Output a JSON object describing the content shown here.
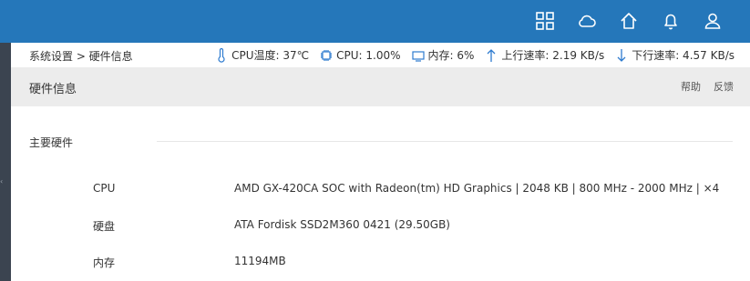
{
  "topbar": {
    "icons": [
      "apps-grid-icon",
      "cloud-icon",
      "home-icon",
      "bell-icon",
      "user-icon"
    ]
  },
  "breadcrumb": {
    "path": "系统设置 > 硬件信息"
  },
  "status": {
    "cpu_temp": "CPU温度: 37℃",
    "cpu_usage": "CPU: 1.00%",
    "memory": "内存: 6%",
    "upload": "上行速率: 2.19 KB/s",
    "download": "下行速率: 4.57 KB/s"
  },
  "page": {
    "title": "硬件信息",
    "help": "帮助",
    "feedback": "反馈"
  },
  "hardware": {
    "section_title": "主要硬件",
    "rows": [
      {
        "key": "CPU",
        "value": "AMD GX-420CA SOC with Radeon(tm) HD Graphics | 2048 KB | 800 MHz - 2000 MHz | ×4"
      },
      {
        "key": "硬盘",
        "value": "ATA Fordisk SSD2M360 0421 (29.50GB)"
      },
      {
        "key": "内存",
        "value": "11194MB"
      }
    ]
  },
  "colors": {
    "topbar": "#2577ba",
    "accent_icon": "#2e7bcf",
    "pagehead_bg": "#ececec"
  }
}
